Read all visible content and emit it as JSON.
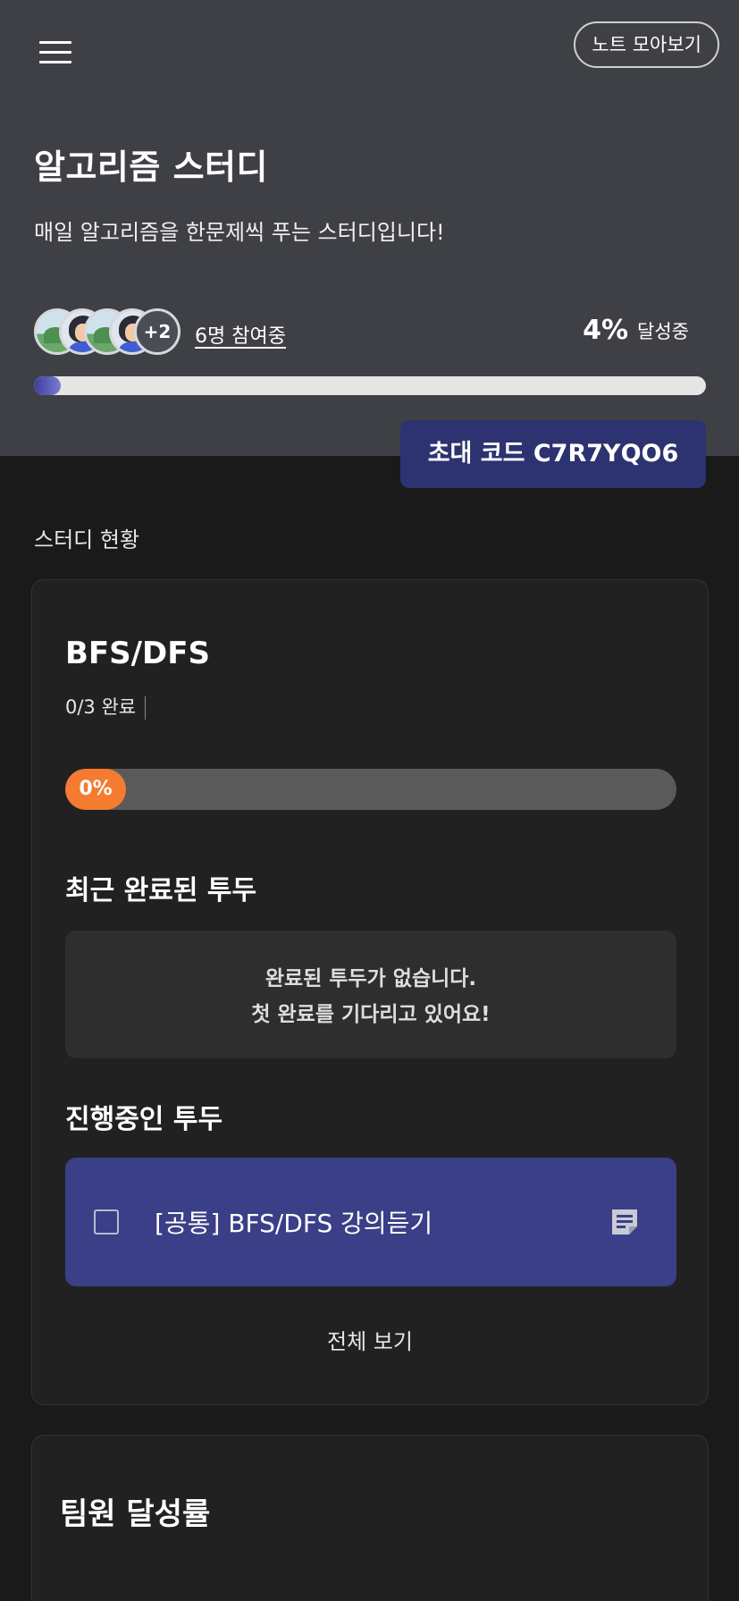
{
  "header": {
    "notes_button": "노트 모아보기",
    "title": "알고리즘 스터디",
    "description": "매일 알고리즘을 한문제씩 푸는 스터디입니다!",
    "avatars_more": "+2",
    "participants": "6명 참여중",
    "achievement_pct": "4%",
    "achievement_label": "달성중",
    "progress": 0.04,
    "invite_code": "초대 코드 C7R7YQO6"
  },
  "section_label": "스터디 현황",
  "todo_card": {
    "name": "BFS/DFS",
    "count": "0/3 완료",
    "progress_label": "0%",
    "progress": 0,
    "recent_heading": "최근 완료된 투두",
    "empty_line1": "완료된 투두가 없습니다.",
    "empty_line2": "첫 완료를 기다리고 있어요!",
    "active_heading": "진행중인 투두",
    "active_items": [
      {
        "text": "[공통] BFS/DFS 강의듣기",
        "checked": false
      }
    ],
    "see_all": "전체 보기"
  },
  "team_card": {
    "title": "팀원 달성률"
  },
  "colors": {
    "header_bg": "#3f4045",
    "page_bg": "#1a1a1a",
    "accent_orange": "#f47b30",
    "accent_indigo": "#3a3f87",
    "invite_bg": "#2d3270"
  }
}
